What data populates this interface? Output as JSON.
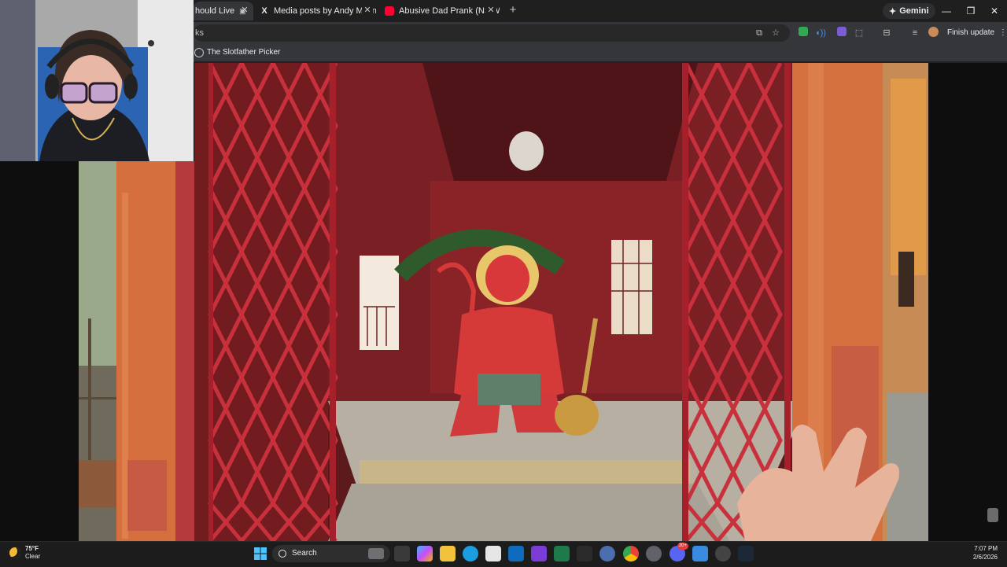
{
  "browser": {
    "tabs": [
      {
        "label": "hould Live",
        "active": true
      },
      {
        "label": "Media posts by Andy Milonakis",
        "favicon": "x-logo-icon"
      },
      {
        "label": "Abusive Dad Prank (NSFW) - Yo",
        "favicon": "youtube-icon"
      }
    ],
    "gemini_label": "Gemini",
    "omnibox_text": "ks",
    "finish_update_label": "Finish update",
    "bookmarks": [
      {
        "label": "The Slotfather Picker"
      }
    ]
  },
  "taskbar": {
    "weather_temp": "75°F",
    "weather_cond": "Clear",
    "search_label": "Search",
    "time": "7:07 PM",
    "date": "2/6/2026",
    "chat_badge": "20+"
  },
  "colors": {
    "shrine_red": "#b8232d",
    "gate_red": "#c8303c",
    "pillar_orange": "#d4713f",
    "chrome_dark": "#202124"
  }
}
